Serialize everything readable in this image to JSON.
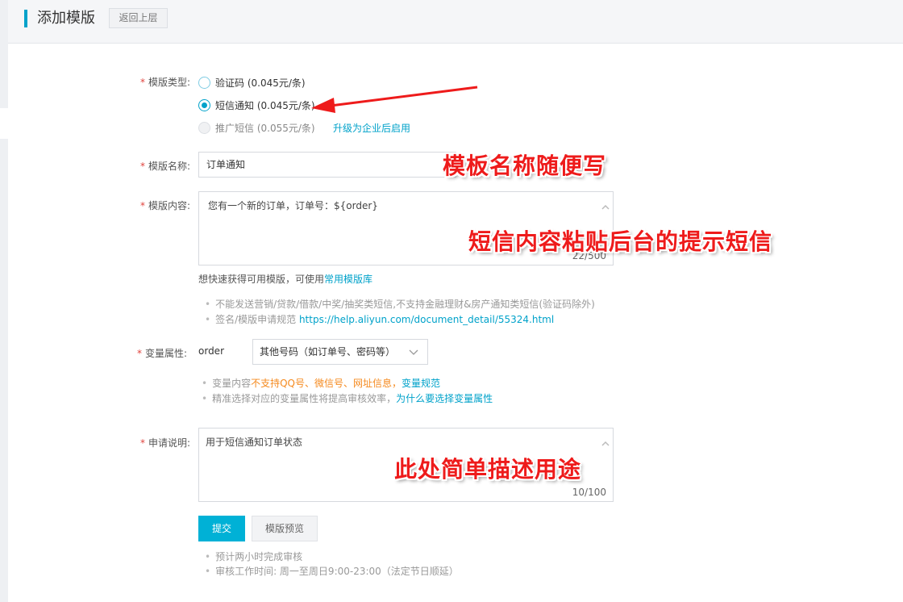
{
  "header": {
    "title": "添加模版",
    "back_label": "返回上层"
  },
  "template_type": {
    "label": "模版类型:",
    "options": [
      {
        "label": "验证码 (0.045元/条)",
        "state": "unchecked"
      },
      {
        "label": "短信通知 (0.045元/条)",
        "state": "checked"
      },
      {
        "label": "推广短信 (0.055元/条)",
        "state": "disabled"
      }
    ],
    "upgrade_link": "升级为企业后启用"
  },
  "template_name": {
    "label": "模版名称:",
    "value": "订单通知"
  },
  "template_content": {
    "label": "模版内容:",
    "value": "您有一个新的订单，订单号：${order}",
    "counter": "22/500",
    "quick_hint_prefix": "想快速获得可用模版，可使用",
    "quick_hint_link": "常用模版库",
    "rule1": "不能发送营销/贷款/借款/中奖/抽奖类短信,不支持金融理财&房产通知类短信(验证码除外)",
    "rule2_prefix": "签名/模版申请规范",
    "rule2_link": "https://help.aliyun.com/document_detail/55324.html"
  },
  "variable": {
    "label": "变量属性:",
    "name": "order",
    "selected": "其他号码（如订单号、密码等）",
    "hint1_prefix": "变量内容",
    "hint1_warning": "不支持QQ号、微信号、网址信息，",
    "hint1_link": "变量规范",
    "hint2_prefix": "精准选择对应的变量属性将提高审核效率，",
    "hint2_link": "为什么要选择变量属性"
  },
  "description": {
    "label": "申请说明:",
    "value": "用于短信通知订单状态",
    "counter": "10/100"
  },
  "actions": {
    "submit": "提交",
    "preview": "模版预览"
  },
  "footer_hints": {
    "line1": "预计两小时完成审核",
    "line2": "审核工作时间: 周一至周日9:00-23:00（法定节日顺延）"
  },
  "annotations": {
    "name_note": "模板名称随便写",
    "content_note": "短信内容粘贴后台的提示短信",
    "desc_note": "此处简单描述用途"
  },
  "colors": {
    "accent": "#00a2ca",
    "primary_button": "#00b1d6",
    "required_star": "#e0443e",
    "warning_text": "#f58a1f",
    "annotation_red": "#ee1b1b"
  }
}
